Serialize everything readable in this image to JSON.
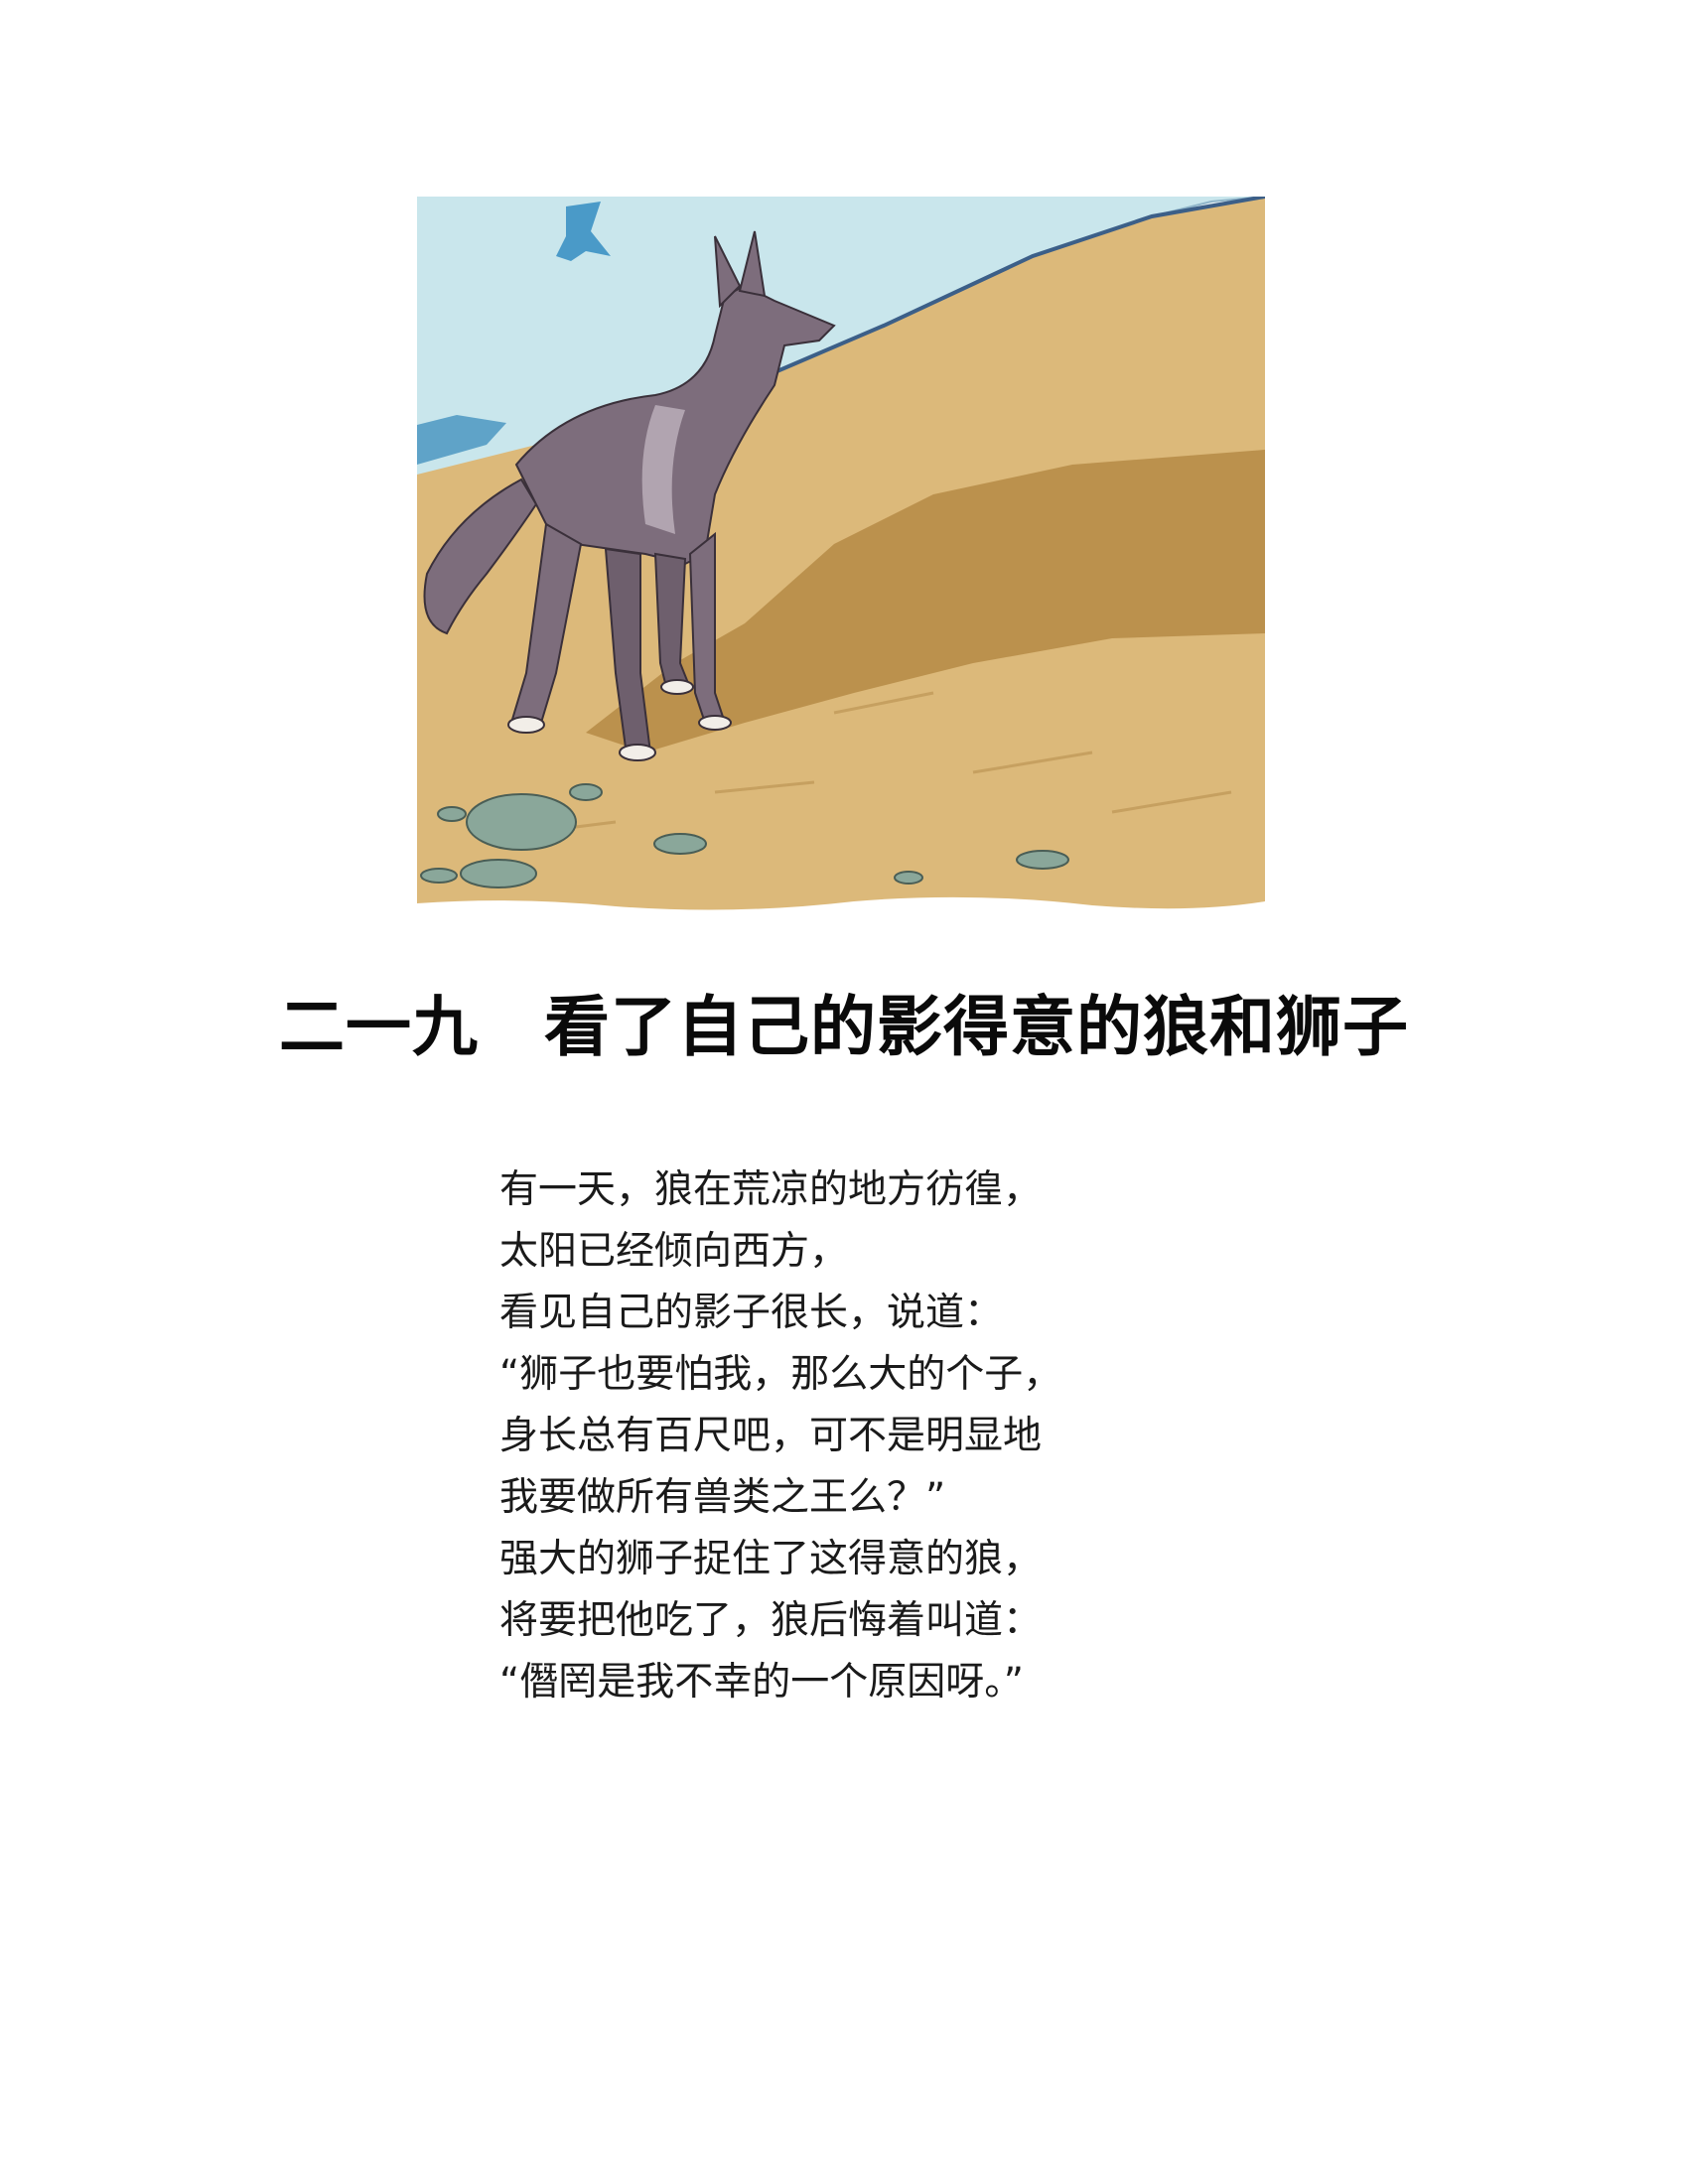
{
  "chapter": {
    "number": "二一九",
    "title": "看了自己的影得意的狼和狮子"
  },
  "illustration": {
    "subject": "wolf",
    "colors": {
      "sky": "#c9e6ec",
      "sand": "#dcb97a",
      "shadow": "#b58a45",
      "wolf": "#7d6d7c",
      "rock": "#8aa79a",
      "sea": "#5fa3c8"
    }
  },
  "poem": {
    "lines": [
      "有一天，狼在荒凉的地方彷徨，",
      "太阳已经倾向西方，",
      "看见自己的影子很长，说道：",
      "“狮子也要怕我，那么大的个子，",
      "身长总有百尺吧，可不是明显地",
      "我要做所有兽类之王么？”",
      "强大的狮子捉住了这得意的狼，",
      "将要把他吃了，狼后悔着叫道：",
      "“僭罔是我不幸的一个原因呀。”"
    ]
  }
}
